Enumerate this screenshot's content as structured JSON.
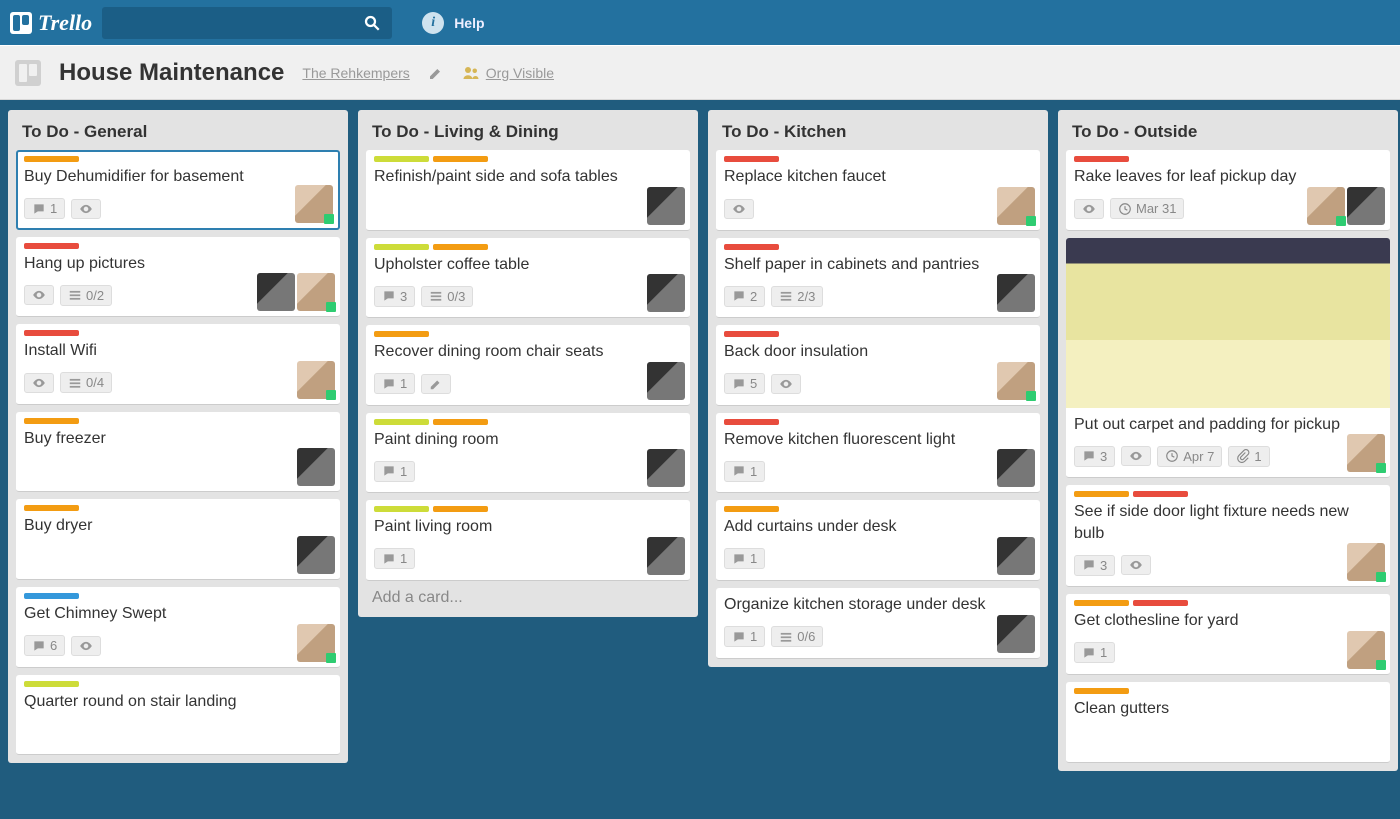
{
  "header": {
    "logo_text": "Trello",
    "search_placeholder": "",
    "help_label": "Help"
  },
  "board_header": {
    "title": "House Maintenance",
    "team": "The Rehkempers",
    "visibility": "Org Visible"
  },
  "add_card_label": "Add a card...",
  "lists": [
    {
      "title": "To Do - General",
      "show_add": false,
      "cards": [
        {
          "selected": true,
          "labels": [
            "orange"
          ],
          "title": "Buy Dehumidifier for basement",
          "badges": [
            {
              "t": "comment",
              "v": "1"
            },
            {
              "t": "watch"
            }
          ],
          "members": [
            "m"
          ]
        },
        {
          "labels": [
            "red"
          ],
          "title": "Hang up pictures",
          "badges": [
            {
              "t": "watch"
            },
            {
              "t": "check",
              "v": "0/2"
            }
          ],
          "members": [
            "f",
            "m"
          ]
        },
        {
          "labels": [
            "red"
          ],
          "title": "Install Wifi",
          "badges": [
            {
              "t": "watch"
            },
            {
              "t": "check",
              "v": "0/4"
            }
          ],
          "members": [
            "m"
          ]
        },
        {
          "labels": [
            "orange"
          ],
          "title": "Buy freezer",
          "badges": [],
          "members": [
            "f"
          ]
        },
        {
          "labels": [
            "orange"
          ],
          "title": "Buy dryer",
          "badges": [],
          "members": [
            "f"
          ]
        },
        {
          "labels": [
            "blue"
          ],
          "title": "Get Chimney Swept",
          "badges": [
            {
              "t": "comment",
              "v": "6"
            },
            {
              "t": "watch"
            }
          ],
          "members": [
            "m"
          ]
        },
        {
          "labels": [
            "yellowgreen"
          ],
          "title": "Quarter round on stair landing",
          "badges": [],
          "members": []
        }
      ]
    },
    {
      "title": "To Do - Living & Dining",
      "show_add": true,
      "cards": [
        {
          "labels": [
            "yellowgreen",
            "orange"
          ],
          "title": "Refinish/paint side and sofa tables",
          "badges": [],
          "members": [
            "f"
          ]
        },
        {
          "labels": [
            "yellowgreen",
            "orange"
          ],
          "title": "Upholster coffee table",
          "badges": [
            {
              "t": "comment",
              "v": "3"
            },
            {
              "t": "check",
              "v": "0/3"
            }
          ],
          "members": [
            "f"
          ]
        },
        {
          "labels": [
            "orange"
          ],
          "title": "Recover dining room chair seats",
          "badges": [
            {
              "t": "comment",
              "v": "1"
            },
            {
              "t": "edit"
            }
          ],
          "members": [
            "f"
          ]
        },
        {
          "labels": [
            "yellowgreen",
            "orange"
          ],
          "title": "Paint dining room",
          "badges": [
            {
              "t": "comment",
              "v": "1"
            }
          ],
          "members": [
            "f"
          ]
        },
        {
          "labels": [
            "yellowgreen",
            "orange"
          ],
          "title": "Paint living room",
          "badges": [
            {
              "t": "comment",
              "v": "1"
            }
          ],
          "members": [
            "f"
          ]
        }
      ]
    },
    {
      "title": "To Do - Kitchen",
      "show_add": false,
      "cards": [
        {
          "labels": [
            "red"
          ],
          "title": "Replace kitchen faucet",
          "badges": [
            {
              "t": "watch"
            }
          ],
          "members": [
            "m"
          ]
        },
        {
          "labels": [
            "red"
          ],
          "title": "Shelf paper in cabinets and pantries",
          "badges": [
            {
              "t": "comment",
              "v": "2"
            },
            {
              "t": "check",
              "v": "2/3"
            }
          ],
          "members": [
            "f"
          ]
        },
        {
          "labels": [
            "red"
          ],
          "title": "Back door insulation",
          "badges": [
            {
              "t": "comment",
              "v": "5"
            },
            {
              "t": "watch"
            }
          ],
          "members": [
            "m"
          ]
        },
        {
          "labels": [
            "red"
          ],
          "title": "Remove kitchen fluorescent light",
          "badges": [
            {
              "t": "comment",
              "v": "1"
            }
          ],
          "members": [
            "f"
          ]
        },
        {
          "labels": [
            "orange"
          ],
          "title": "Add curtains under desk",
          "badges": [
            {
              "t": "comment",
              "v": "1"
            }
          ],
          "members": [
            "f"
          ]
        },
        {
          "labels": [],
          "title": "Organize kitchen storage under desk",
          "badges": [
            {
              "t": "comment",
              "v": "1"
            },
            {
              "t": "check",
              "v": "0/6"
            }
          ],
          "members": [
            "f"
          ]
        }
      ]
    },
    {
      "title": "To Do - Outside",
      "show_add": false,
      "cards": [
        {
          "labels": [
            "red"
          ],
          "title": "Rake leaves for leaf pickup day",
          "badges": [
            {
              "t": "watch"
            },
            {
              "t": "date",
              "v": "Mar 31"
            }
          ],
          "members": [
            "m",
            "f"
          ]
        },
        {
          "cover": true,
          "labels": [],
          "title": "Put out carpet and padding for pickup",
          "badges": [
            {
              "t": "comment",
              "v": "3"
            },
            {
              "t": "watch"
            },
            {
              "t": "date",
              "v": "Apr 7"
            },
            {
              "t": "attach",
              "v": "1"
            }
          ],
          "members": [
            "m"
          ]
        },
        {
          "labels": [
            "orange",
            "red"
          ],
          "title": "See if side door light fixture needs new bulb",
          "badges": [
            {
              "t": "comment",
              "v": "3"
            },
            {
              "t": "watch"
            }
          ],
          "members": [
            "m"
          ]
        },
        {
          "labels": [
            "orange",
            "red"
          ],
          "title": "Get clothesline for yard",
          "badges": [
            {
              "t": "comment",
              "v": "1"
            }
          ],
          "members": [
            "m"
          ]
        },
        {
          "labels": [
            "orange"
          ],
          "title": "Clean gutters",
          "badges": [],
          "members": []
        }
      ]
    }
  ]
}
